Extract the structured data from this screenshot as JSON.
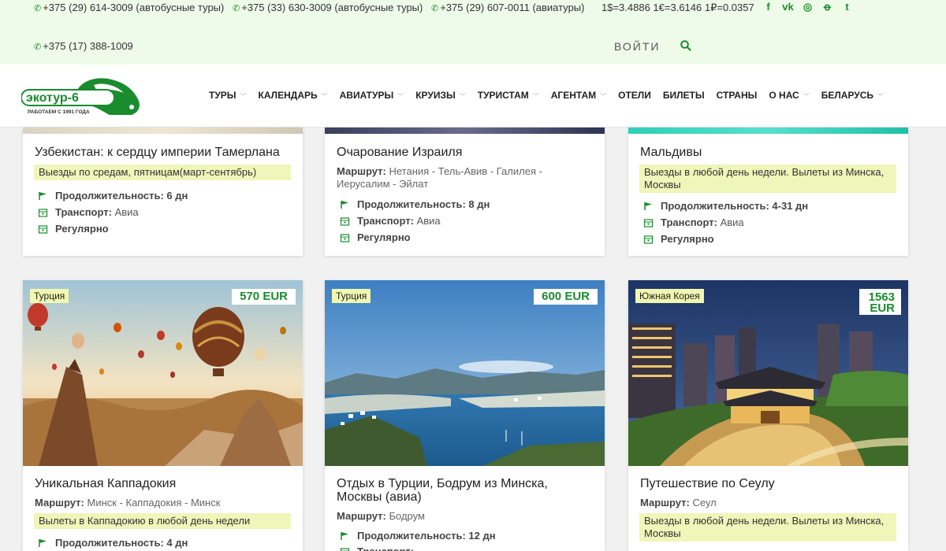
{
  "topbar": {
    "phones": [
      {
        "number": "+375 (29) 614-3009",
        "note": "(автобусные туры)"
      },
      {
        "number": "+375 (33) 630-3009",
        "note": "(автобусные туры)"
      },
      {
        "number": "+375 (29) 607-0011",
        "note": "(авиатуры)"
      },
      {
        "number": "+375 (17) 388-1009",
        "note": ""
      }
    ],
    "rates": "1$=3.4886 1€=3.6146 1₽=0.0357",
    "socials": [
      {
        "name": "facebook-icon",
        "glyph": "f"
      },
      {
        "name": "vk-icon",
        "glyph": "vk"
      },
      {
        "name": "instagram-icon",
        "glyph": "◎"
      },
      {
        "name": "odnoklassniki-icon",
        "glyph": "ꝋ"
      },
      {
        "name": "twitter-icon",
        "glyph": "t"
      }
    ],
    "login_label": "ВОЙТИ"
  },
  "logo": {
    "name": "экотур-6",
    "tagline": "РАБОТАЕМ С 1991 ГОДА"
  },
  "nav": {
    "items": [
      {
        "label": "ТУРЫ",
        "dropdown": true
      },
      {
        "label": "КАЛЕНДАРЬ",
        "dropdown": true
      },
      {
        "label": "АВИАТУРЫ",
        "dropdown": true
      },
      {
        "label": "КРУИЗЫ",
        "dropdown": true
      },
      {
        "label": "ТУРИСТАМ",
        "dropdown": true
      },
      {
        "label": "АГЕНТАМ",
        "dropdown": true
      },
      {
        "label": "ОТЕЛИ",
        "dropdown": false
      },
      {
        "label": "БИЛЕТЫ",
        "dropdown": false
      },
      {
        "label": "СТРАНЫ",
        "dropdown": false
      },
      {
        "label": "О НАС",
        "dropdown": true
      },
      {
        "label": "БЕЛАРУСЬ",
        "dropdown": true
      }
    ]
  },
  "labels": {
    "route": "Маршрут:",
    "duration": "Продолжительность:",
    "transport": "Транспорт:",
    "regular": "Регулярно"
  },
  "tours_row1": [
    {
      "title": "Узбекистан: к сердцу империи Тамерлана",
      "note": "Выезды по средам, пятницам(март-сентябрь)",
      "duration": "6 дн",
      "transport": "Авиа"
    },
    {
      "title": "Очарование Израиля",
      "route": "Нетания - Тель-Авив - Галилея - Иерусалим - Эйлат",
      "duration": "8 дн",
      "transport": "Авиа"
    },
    {
      "title": "Мальдивы",
      "note": "Выезды в любой день недели. Вылеты из Минска, Москвы",
      "duration": "4-31 дн",
      "transport": "Авиа"
    }
  ],
  "tours_row2": [
    {
      "country": "Турция",
      "price": "570 EUR",
      "title": "Уникальная Каппадокия",
      "route": "Минск - Каппадокия - Минск",
      "note": "Вылеты в Каппадокию в любой день недели",
      "duration": "4 дн"
    },
    {
      "country": "Турция",
      "price": "600 EUR",
      "title": "Отдых в Турции, Бодрум из Минска, Москвы (авиа)",
      "route": "Бодрум",
      "duration": "12 дн"
    },
    {
      "country": "Южная Корея",
      "price_line1": "1563",
      "price_line2": "EUR",
      "title": "Путешествие по Сеулу",
      "route": "Сеул",
      "note": "Выезды в любой день недели. Вылеты из Минска, Москвы"
    }
  ],
  "colors": {
    "brand_green": "#1a8c2e",
    "topbar_bg": "#effbe9",
    "note_bg": "#eef6b9"
  }
}
